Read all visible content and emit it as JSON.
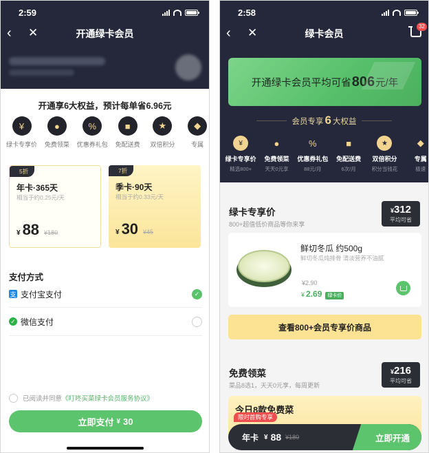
{
  "left": {
    "status": {
      "time": "2:59"
    },
    "nav": {
      "title": "开通绿卡会员"
    },
    "headline": "开通享6大权益，预计每单省6.96元",
    "benefits": [
      {
        "label": "绿卡专享价",
        "glyph": "¥"
      },
      {
        "label": "免费领菜",
        "glyph": "●"
      },
      {
        "label": "优惠券礼包",
        "glyph": "%"
      },
      {
        "label": "免配送费",
        "glyph": "■"
      },
      {
        "label": "双倍积分",
        "glyph": "★"
      },
      {
        "label": "专属",
        "glyph": "◆"
      }
    ],
    "plans": [
      {
        "tag": "5折",
        "name": "年卡·365天",
        "desc": "相当于约0.25元/天",
        "currency": "¥",
        "price": "88",
        "original": "¥180"
      },
      {
        "tag": "7折",
        "name": "季卡·90天",
        "desc": "相当于约0.33元/天",
        "currency": "¥",
        "price": "30",
        "original": "¥45"
      }
    ],
    "payment": {
      "title": "支付方式",
      "options": [
        {
          "label": "支付宝支付",
          "icon": "支",
          "selected": true
        },
        {
          "label": "微信支付",
          "icon": "✓",
          "selected": false
        }
      ]
    },
    "agreement": {
      "prefix": "已阅读并同意",
      "link": "《叮咚买菜绿卡会员服务协议》"
    },
    "pay_button": {
      "label": "立即支付",
      "currency": "¥",
      "amount": "30"
    }
  },
  "right": {
    "status": {
      "time": "2:58"
    },
    "nav": {
      "title": "绿卡会员",
      "cart_count": "32"
    },
    "banner": {
      "prefix": "开通绿卡会员平均可省",
      "amount": "806",
      "suffix": "元/年"
    },
    "exclusive": {
      "prefix": "会员专享",
      "count": "6",
      "suffix": "大权益"
    },
    "benefits": [
      {
        "label": "绿卡专享价",
        "sub": "精选800+",
        "glyph": "¥"
      },
      {
        "label": "免费领菜",
        "sub": "天天0元享",
        "glyph": "●"
      },
      {
        "label": "优惠券礼包",
        "sub": "88元/月",
        "glyph": "%"
      },
      {
        "label": "免配送费",
        "sub": "6次/月",
        "glyph": "■"
      },
      {
        "label": "双倍积分",
        "sub": "积分当钱花",
        "glyph": "★"
      },
      {
        "label": "专属",
        "sub": "极速",
        "glyph": "◆"
      }
    ],
    "section1": {
      "title": "绿卡专享价",
      "subtitle": "800+超值低价商品等你来享",
      "save_currency": "¥",
      "save_value": "312",
      "save_label": "平均可省"
    },
    "product": {
      "name": "鲜切冬瓜 约500g",
      "desc": "鲜切冬瓜炖排骨 清淡营养不油腻",
      "original_price": "¥2.90",
      "currency": "¥",
      "member_price": "2.69",
      "member_tag": "绿卡价"
    },
    "view_more": "查看800+会员专享价商品",
    "section2": {
      "title": "免费领菜",
      "subtitle": "菜品8选1，天天0元享，每周更新",
      "save_currency": "¥",
      "save_value": "216",
      "save_label": "平均可省"
    },
    "today": {
      "title": "今日8款免费菜"
    },
    "promo_tag": "限时首购专享",
    "bottom": {
      "plan": "年卡",
      "currency": "¥",
      "price": "88",
      "original": "¥180",
      "button": "立即开通"
    }
  },
  "colors": {
    "dark": "#24283a",
    "green": "#5bc46c",
    "gold": "#f2d38f",
    "yellow": "#fce394",
    "red": "#f04e4e"
  }
}
